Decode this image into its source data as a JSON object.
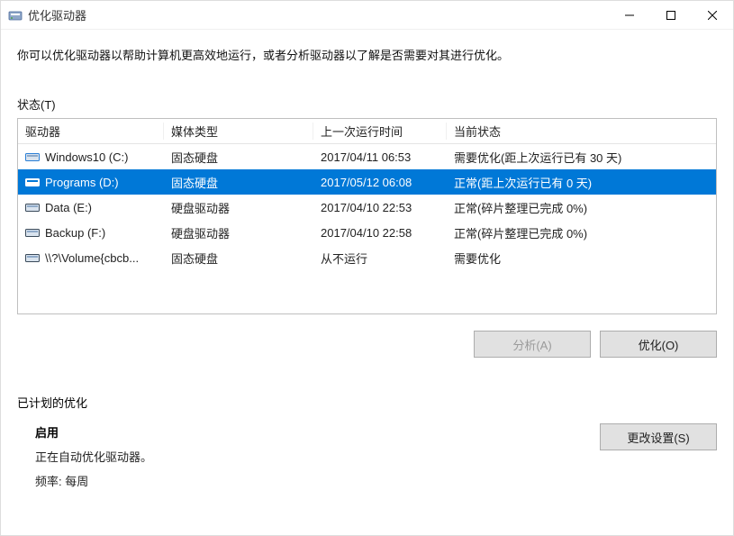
{
  "window": {
    "title": "优化驱动器"
  },
  "description": "你可以优化驱动器以帮助计算机更高效地运行，或者分析驱动器以了解是否需要对其进行优化。",
  "statusLabel": "状态(T)",
  "columns": {
    "drive": "驱动器",
    "media": "媒体类型",
    "lastRun": "上一次运行时间",
    "current": "当前状态"
  },
  "drives": [
    {
      "name": "Windows10 (C:)",
      "media": "固态硬盘",
      "lastRun": "2017/04/11 06:53",
      "status": "需要优化(距上次运行已有 30 天)",
      "selected": false,
      "iconColor": "#2a7fd6",
      "iconType": "os"
    },
    {
      "name": "Programs (D:)",
      "media": "固态硬盘",
      "lastRun": "2017/05/12 06:08",
      "status": "正常(距上次运行已有 0 天)",
      "selected": true,
      "iconColor": "#3a4a5a",
      "iconType": "hdd"
    },
    {
      "name": "Data (E:)",
      "media": "硬盘驱动器",
      "lastRun": "2017/04/10 22:53",
      "status": "正常(碎片整理已完成 0%)",
      "selected": false,
      "iconColor": "#3a4a5a",
      "iconType": "hdd"
    },
    {
      "name": "Backup (F:)",
      "media": "硬盘驱动器",
      "lastRun": "2017/04/10 22:58",
      "status": "正常(碎片整理已完成 0%)",
      "selected": false,
      "iconColor": "#3a4a5a",
      "iconType": "hdd"
    },
    {
      "name": "\\\\?\\Volume{cbcb...",
      "media": "固态硬盘",
      "lastRun": "从不运行",
      "status": "需要优化",
      "selected": false,
      "iconColor": "#3a4a5a",
      "iconType": "hdd"
    }
  ],
  "buttons": {
    "analyze": "分析(A)",
    "optimize": "优化(O)",
    "changeSettings": "更改设置(S)"
  },
  "schedule": {
    "sectionLabel": "已计划的优化",
    "enabledLabel": "启用",
    "statusText": "正在自动优化驱动器。",
    "frequencyLabel": "频率: 每周"
  }
}
